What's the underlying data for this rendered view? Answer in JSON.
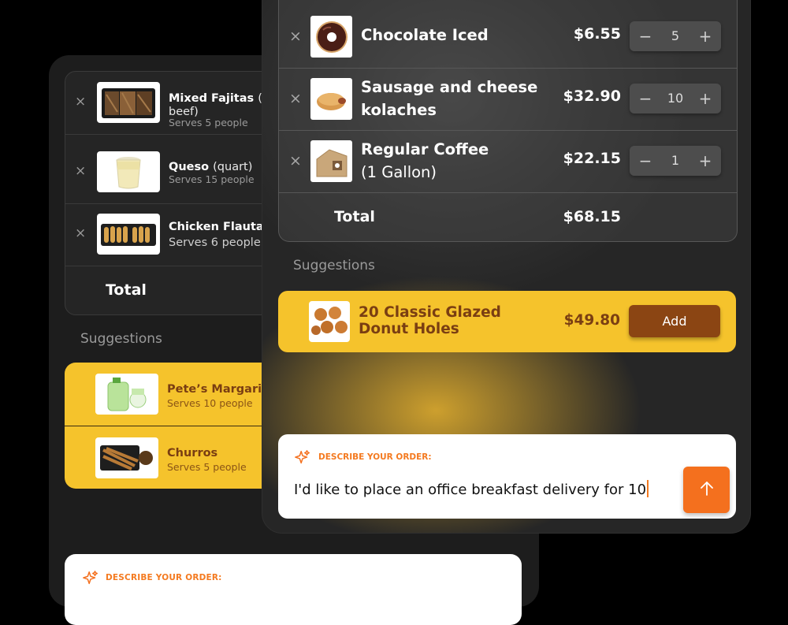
{
  "back_panel": {
    "cart_items": [
      {
        "name": "Mixed Fajitas",
        "name_extra": "(c",
        "name_line2": "beef)",
        "serves": "Serves 5 people",
        "icon": "fajitas-tray-image"
      },
      {
        "name": "Queso",
        "name_extra": "(quart)",
        "serves": "Serves 15 people",
        "icon": "queso-cup-image"
      },
      {
        "name": "Chicken Flautas",
        "name_extra": "",
        "serves": "Serves 6 people",
        "icon": "flautas-tray-image"
      }
    ],
    "total_label": "Total",
    "suggestions_label": "Suggestions",
    "suggestions": [
      {
        "name": "Pete’s Margarita",
        "serves": "Serves 10 people",
        "icon": "margarita-jug-image"
      },
      {
        "name": "Churros",
        "serves": "Serves 5 people",
        "icon": "churros-tray-image"
      }
    ],
    "describe_label": "DESCRIBE YOUR ORDER:"
  },
  "front_panel": {
    "cart_items": [
      {
        "name": "Chocolate Iced",
        "name_line2": "",
        "price": "$6.55",
        "quantity": "5",
        "icon": "chocolate-donut-image"
      },
      {
        "name": "Sausage and cheese",
        "name_line2": "kolaches",
        "price": "$32.90",
        "quantity": "10",
        "icon": "kolache-image"
      },
      {
        "name": "Regular Coffee",
        "name_line2": "(1 Gallon)",
        "price": "$22.15",
        "quantity": "1",
        "icon": "coffee-box-image"
      }
    ],
    "stepper": {
      "minus": "−",
      "plus": "+"
    },
    "total_label": "Total",
    "total_value": "$68.15",
    "suggestions_label": "Suggestions",
    "suggestion": {
      "name": "20 Classic Glazed Donut Holes",
      "price": "$49.80",
      "add_label": "Add",
      "icon": "donut-holes-image"
    },
    "describe_label": "DESCRIBE YOUR ORDER:",
    "describe_value": "I'd like to place an office breakfast delivery for 10"
  },
  "colors": {
    "accent_orange": "#f4701e",
    "suggestion_yellow": "#f5c32c",
    "add_button_brown": "#8b4513",
    "suggestion_text_brown": "#7a3e12"
  },
  "icons": {
    "remove": "×",
    "sparkle": "sparkle-icon",
    "send": "arrow-up-icon"
  }
}
